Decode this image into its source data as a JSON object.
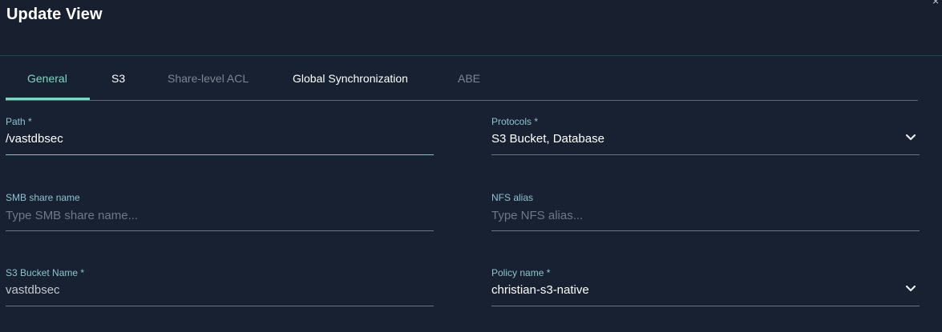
{
  "dialog": {
    "title": "Update View",
    "close_symbol": "×"
  },
  "tabs": [
    {
      "label": "General",
      "state": "active"
    },
    {
      "label": "S3",
      "state": "enabled"
    },
    {
      "label": "Share-level ACL",
      "state": "disabled"
    },
    {
      "label": "Global Synchronization",
      "state": "enabled"
    },
    {
      "label": "ABE",
      "state": "disabled"
    }
  ],
  "form": {
    "path": {
      "label": "Path *",
      "value": "/vastdbsec"
    },
    "protocols": {
      "label": "Protocols *",
      "value": "S3 Bucket, Database",
      "icon": "chevron-down-icon"
    },
    "smb_share_name": {
      "label": "SMB share name",
      "placeholder": "Type SMB share name..."
    },
    "nfs_alias": {
      "label": "NFS alias",
      "placeholder": "Type NFS alias..."
    },
    "s3_bucket_name": {
      "label": "S3 Bucket Name *",
      "value": "vastdbsec"
    },
    "policy_name": {
      "label": "Policy name *",
      "value": "christian-s3-native",
      "icon": "chevron-down-icon"
    }
  },
  "colors": {
    "background": "#172131",
    "accent": "#7fd6c2",
    "label": "#8fc3d0"
  }
}
